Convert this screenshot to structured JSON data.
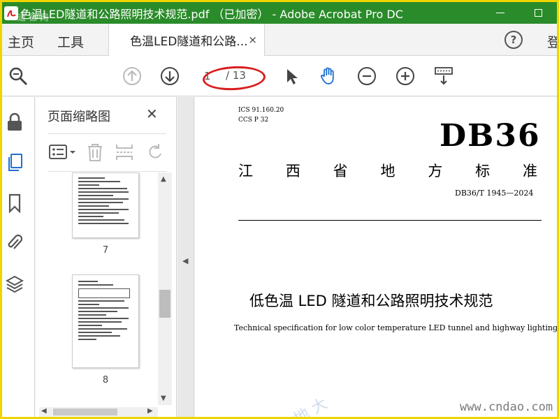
{
  "window": {
    "title": "色温LED隧道和公路照明技术规范.pdf （已加密） - Adobe Acrobat Pro DC",
    "watermark_top": "道 德 网"
  },
  "tabs": {
    "home": "主页",
    "tools": "工具",
    "document": "色温LED隧道和公路...",
    "close_glyph": "×",
    "help_glyph": "?",
    "login": "登"
  },
  "toolbar": {
    "current_page": "1",
    "total_pages": "/ 13"
  },
  "thumbnails": {
    "title": "页面缩略图",
    "close_glyph": "✕",
    "items": [
      {
        "label": "7"
      },
      {
        "label": "8"
      }
    ]
  },
  "document": {
    "ics": "ICS  91.160.20",
    "ccs": "CCS  P  32",
    "code": "DB36",
    "standard_chars": [
      "江",
      "西",
      "省",
      "地",
      "方",
      "标",
      "准"
    ],
    "number": "DB36/T  1945—2024",
    "title_cn": "低色温 LED 隧道和公路照明技术规范",
    "title_en": "Technical specification for low color temperature LED tunnel and highway lighting"
  },
  "watermarks": {
    "url": "www.cndao.com",
    "diagonal": "地 大"
  },
  "colors": {
    "titlebar": "#2a8b2a",
    "frame": "#f0d400",
    "hand_tool": "#1f6fd1",
    "annotation_circle": "#d81e1e"
  }
}
